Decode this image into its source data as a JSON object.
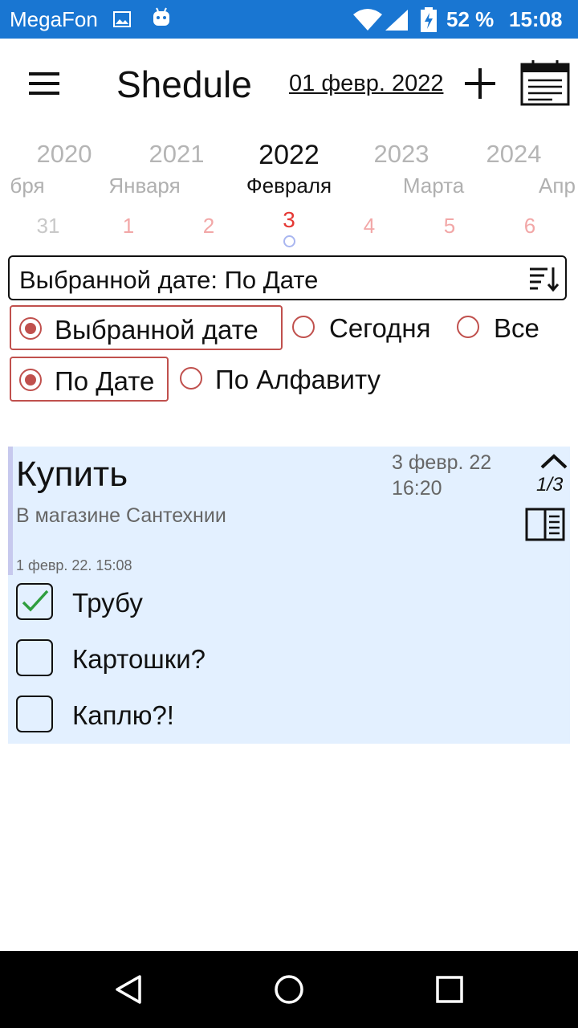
{
  "status_bar": {
    "carrier": "MegaFon",
    "battery": "52 %",
    "time": "15:08"
  },
  "app_bar": {
    "title": "Shedule",
    "date": "01 февр. 2022"
  },
  "picker": {
    "years": [
      "2020",
      "2021",
      "2022",
      "2023",
      "2024"
    ],
    "months": [
      "бря",
      "Января",
      "Февраля",
      "Марта",
      "Апр"
    ],
    "days": [
      "31",
      "1",
      "2",
      "3",
      "4",
      "5",
      "6"
    ],
    "selected_day_color": "#e53935"
  },
  "filter": {
    "summary": "Выбранной дате: По Дате"
  },
  "radio_group_1": [
    {
      "label": "Выбранной дате",
      "checked": true
    },
    {
      "label": "Сегодня",
      "checked": false
    },
    {
      "label": "Все",
      "checked": false
    }
  ],
  "radio_group_2": [
    {
      "label": "По Дате",
      "checked": true
    },
    {
      "label": "По Алфавиту",
      "checked": false
    }
  ],
  "card": {
    "title": "Купить",
    "subtitle": "В магазине Сантехнии",
    "due_date": "3 февр. 22",
    "due_time": "16:20",
    "counter": "1/3",
    "created": "1 февр. 22. 15:08",
    "items": [
      {
        "text": "Трубу",
        "checked": true
      },
      {
        "text": "Картошки?",
        "checked": false
      },
      {
        "text": "Каплю?!",
        "checked": false
      }
    ],
    "background": "#e3f0ff"
  },
  "colors": {
    "status_bar": "#1976d2",
    "accent_red": "#c0504d",
    "check_green": "#2e9e3e"
  }
}
